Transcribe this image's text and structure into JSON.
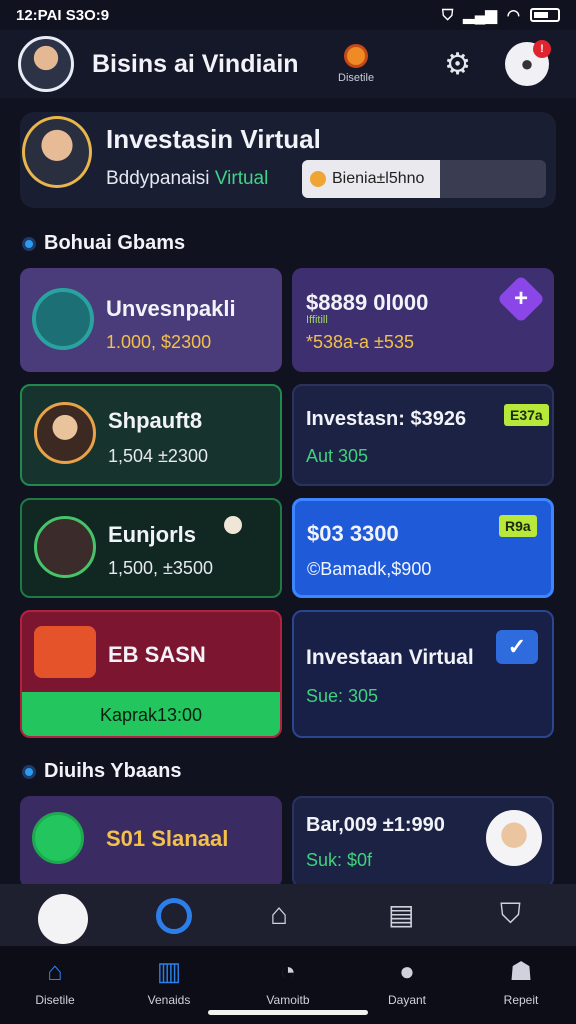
{
  "status_bar": {
    "time": "12:PAI S3O:9",
    "right_icons": [
      "shield-icon",
      "signal-icon",
      "wifi-icon",
      "battery-icon"
    ]
  },
  "header": {
    "title": "Bisins ai Vindiain",
    "logo_label": "Disetile",
    "bell_badge": "!"
  },
  "profile": {
    "title": "Investasin Virtual",
    "subtitle_prefix": "Bddypanaisi",
    "subtitle_accent": "Virtual",
    "pill_label": "Bienia±l5hno"
  },
  "section1": {
    "title": "Bohuai Gbams"
  },
  "cards": [
    {
      "title": "Unvesnpakli",
      "value": "1.000, $2300",
      "icon": "stack-icon"
    },
    {
      "title": "$8889 0l000",
      "note": "Iffitill",
      "value": "*538a-a ±535",
      "icon": "plus-icon"
    },
    {
      "title": "Shpauft8",
      "value": "1,504 ±2300",
      "icon": "person-icon"
    },
    {
      "title": "Investasn: $3926",
      "value": "Aut 305",
      "tag": "E37a"
    },
    {
      "title": "Eunjorls",
      "value": "1,500, ±3500",
      "icon": "slash-icon"
    },
    {
      "title": "$03 3300",
      "value": "©Bamadk,$900",
      "tag": "R9a"
    },
    {
      "title": "EB SASN",
      "button": "Kaprak13:00",
      "icon": "receipt-icon"
    },
    {
      "title": "Investaan Virtual",
      "value": "Sue: 305",
      "icon": "check-icon"
    }
  ],
  "section2": {
    "title": "Diuihs Ybaans"
  },
  "bottom_cards": [
    {
      "title": "S01 Slanaal",
      "icon": "dial-icon"
    },
    {
      "title": "Bar,009 ±1:990",
      "value": "Suk: $0f",
      "icon": "person-icon"
    }
  ],
  "tabs_top": [
    "logo-icon",
    "compass-icon",
    "home-icon",
    "document-icon",
    "shield-icon"
  ],
  "tabs": [
    {
      "label": "Disetile",
      "icon": "home-icon"
    },
    {
      "label": "Venaids",
      "icon": "chart-icon"
    },
    {
      "label": "Vamoitb",
      "icon": "clock-icon"
    },
    {
      "label": "Dayant",
      "icon": "chat-icon"
    },
    {
      "label": "Repeit",
      "icon": "user-icon"
    }
  ],
  "colors": {
    "accent_green": "#22c55e",
    "accent_blue": "#1f5ad8",
    "accent_purple": "#8b46e8",
    "accent_red": "#7c1630"
  }
}
